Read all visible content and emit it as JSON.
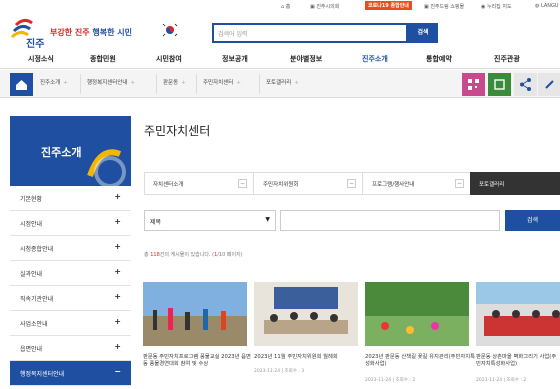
{
  "util": {
    "home": "홈",
    "civil": "진주시의회",
    "corona": "코로나19 종합안내",
    "mall": "진주드림 쇼핑몰",
    "sitemap": "누리집 지도",
    "lang": "LANGU"
  },
  "header": {
    "logo_text": "진주",
    "slogan_1": "부강한 진주",
    "slogan_2": "행복한 시민",
    "search_placeholder": "검색어 입력",
    "search_button": "검색"
  },
  "gnb": [
    "시정소식",
    "종합민원",
    "시민참여",
    "정보공개",
    "분야별정보",
    "진주소개",
    "통합예약",
    "진주관광"
  ],
  "breadcrumb": [
    "진주소개",
    "행정복지센터안내",
    "판문동",
    "주민자치센터",
    "포토갤러리"
  ],
  "sidebar": {
    "title": "진주소개",
    "items": [
      "기본현황",
      "시정안내",
      "시청종합안내",
      "실과안내",
      "직속기관안내",
      "사업소안내",
      "읍면안내",
      "행정복지센터안내"
    ]
  },
  "main": {
    "title": "주민자치센터",
    "tabs": [
      "자치센터소개",
      "주민자치위원회",
      "프로그램/행사안내",
      "포토갤러리"
    ],
    "search_select": "제목",
    "search_button": "검색",
    "total_prefix": "총",
    "total_count": "118",
    "total_suffix": "건의 게시물이 있습니다. (",
    "page_current": "1",
    "page_rest": "/10 페이지)",
    "gallery": [
      {
        "caption": "판문동 주민자치프로그램 풍물교실 2023년 읍면동 풍물경연대회 참여 및 수상",
        "date": "",
        "views": ""
      },
      {
        "caption": "2023년 11월 주민자치위원회 월례회",
        "date": "2023-11-24",
        "views": "조회수 : 3"
      },
      {
        "caption": "2023년 판문동 산책길 꽃길 유지관리(주민자치특성화사업)",
        "date": "2023-11-24",
        "views": "조회수 : 2"
      },
      {
        "caption": "판문동 상촌마을 벽화그리기 사업(주민자치특성화사업)",
        "date": "2023-11-24",
        "views": "조회수 : 2"
      }
    ]
  },
  "colors": {
    "primary": "#1f4fa0",
    "accent": "#d62b2b",
    "corona": "#e94f1b"
  }
}
